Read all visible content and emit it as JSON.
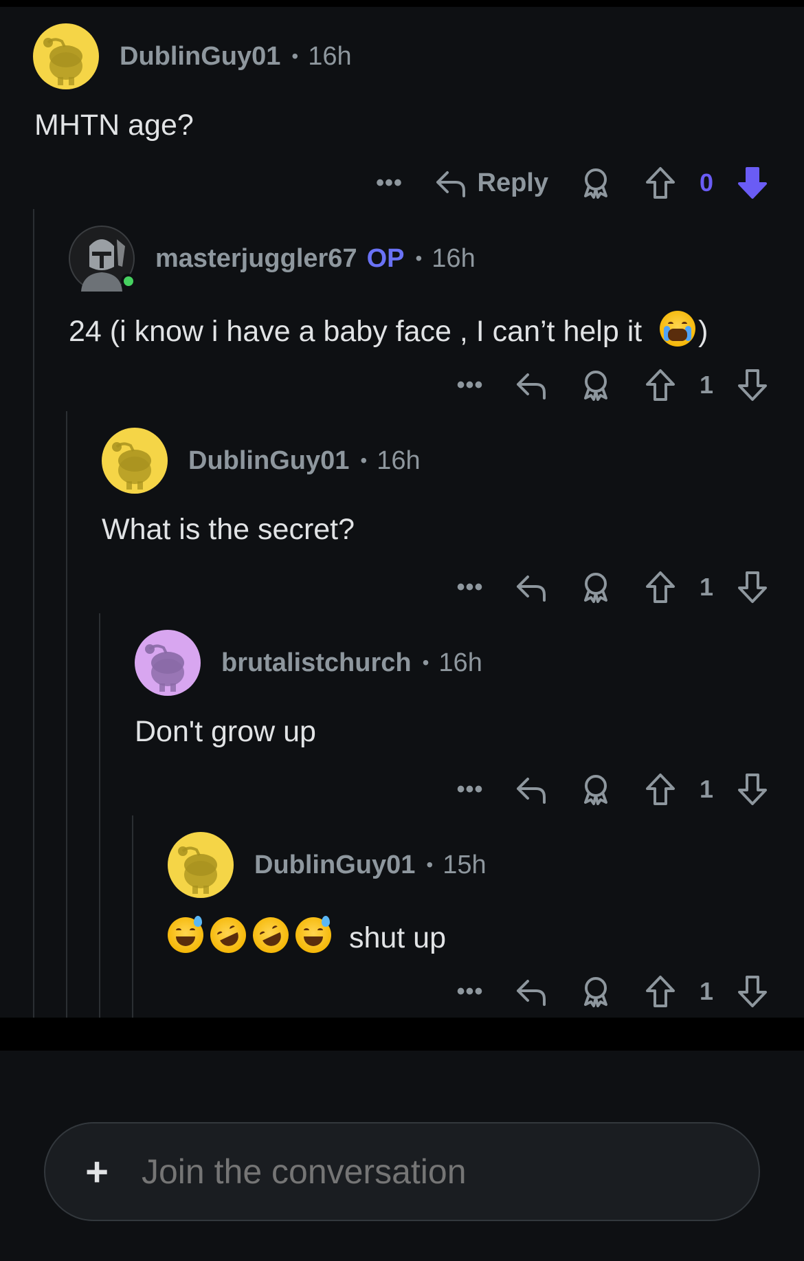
{
  "comments": [
    {
      "username": "DublinGuy01",
      "op": "",
      "time": "16h",
      "text": "MHTN age?",
      "votes": "0",
      "reply_label": "Reply",
      "avatar_color": "#f5d547",
      "avatar_icon": "snoo-default-avatar",
      "downvoted": true
    },
    {
      "username": "masterjuggler67",
      "op": "OP",
      "time": "16h",
      "text": "24 (i know i have a baby face , I can’t help it",
      "text_after": ")",
      "emoji": "loudly-crying-face",
      "votes": "1",
      "avatar_icon": "mandalorian-photo-avatar",
      "online": true
    },
    {
      "username": "DublinGuy01",
      "time": "16h",
      "text": "What is the secret?",
      "votes": "1",
      "avatar_color": "#f5d547",
      "avatar_icon": "snoo-default-avatar"
    },
    {
      "username": "brutalistchurch",
      "time": "16h",
      "text": "Don't grow up",
      "votes": "1",
      "avatar_color": "#d8a6f0",
      "avatar_icon": "snoo-default-avatar"
    },
    {
      "username": "DublinGuy01",
      "time": "15h",
      "text": "shut up",
      "emojis": [
        "grinning-face-with-sweat",
        "rolling-on-the-floor-laughing",
        "rolling-on-the-floor-laughing",
        "grinning-face-with-sweat"
      ],
      "votes": "1",
      "avatar_color": "#f5d547",
      "avatar_icon": "snoo-default-avatar"
    }
  ],
  "composer": {
    "placeholder": "Join the conversation",
    "plus_icon": "plus-icon"
  },
  "colors": {
    "background": "#0e1013",
    "op_badge": "#6a72f5",
    "downvote_active": "#6a5cf5",
    "meta_text": "#8e979e"
  }
}
